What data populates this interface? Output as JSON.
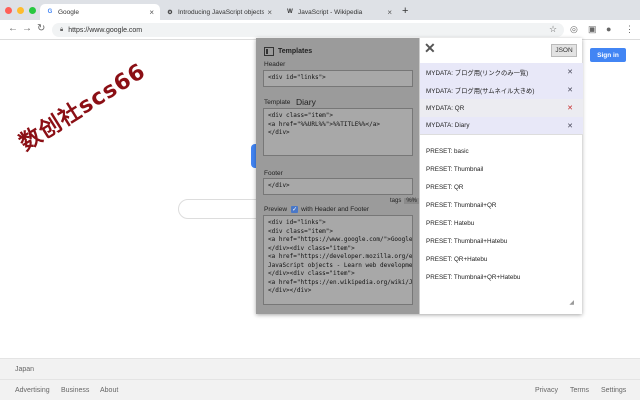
{
  "browser": {
    "window_lights": [
      "#ff5f57",
      "#febc2e",
      "#28c840"
    ],
    "tabs": [
      {
        "favicon": "G",
        "title": "Google",
        "active": true
      },
      {
        "favicon": "⚙",
        "title": "Introducing JavaScript objects",
        "active": false
      },
      {
        "favicon": "W",
        "title": "JavaScript - Wikipedia",
        "active": false
      }
    ],
    "new_tab": "+",
    "url": "https://www.google.com"
  },
  "google": {
    "signin_label": "Sign in",
    "footer": {
      "country": "Japan",
      "left_links": [
        "Advertising",
        "Business",
        "About"
      ],
      "right_links": [
        "Privacy",
        "Terms",
        "Settings"
      ]
    }
  },
  "stamp_text": "数创社scs66",
  "extension": {
    "title": "Templates",
    "header_label": "Header",
    "header_value": "<div id=\"links\">",
    "template_label": "Template",
    "template_name": "Diary",
    "template_value": "<div class=\"item\">\n<a href=\"%%URL%%\">%%TITLE%%</a>\n</div>",
    "tags_label": "tags",
    "tags_chip": "%%",
    "footer_label": "Footer",
    "footer_value": "</div>",
    "preview_label": "Preview",
    "preview_checkbox_label": "with Header and Footer",
    "preview_value": "<div id=\"links\">\n<div class=\"item\">\n<a href=\"https://www.google.com/\">Google</a>\n</div><div class=\"item\">\n<a href=\"https://developer.mozilla.org/en-US/d\nJavaScript objects - Learn web development |\n</div><div class=\"item\">\n<a href=\"https://en.wikipedia.org/wiki/JavaScri\n</div></div>",
    "json_button": "JSON",
    "mydata_items": [
      {
        "label": "MYDATA: ブログ用(リンクのみ一覧)",
        "selected": false
      },
      {
        "label": "MYDATA: ブログ用(サムネイル大きめ)",
        "selected": false
      },
      {
        "label": "MYDATA: QR",
        "selected": true
      },
      {
        "label": "MYDATA: Diary",
        "selected": false
      }
    ],
    "preset_items": [
      "PRESET: basic",
      "PRESET: Thumbnail",
      "PRESET: QR",
      "PRESET: Thumbnail+QR",
      "PRESET: Hatebu",
      "PRESET: Thumbnail+Hatebu",
      "PRESET: QR+Hatebu",
      "PRESET: Thumbnail+QR+Hatebu"
    ]
  }
}
